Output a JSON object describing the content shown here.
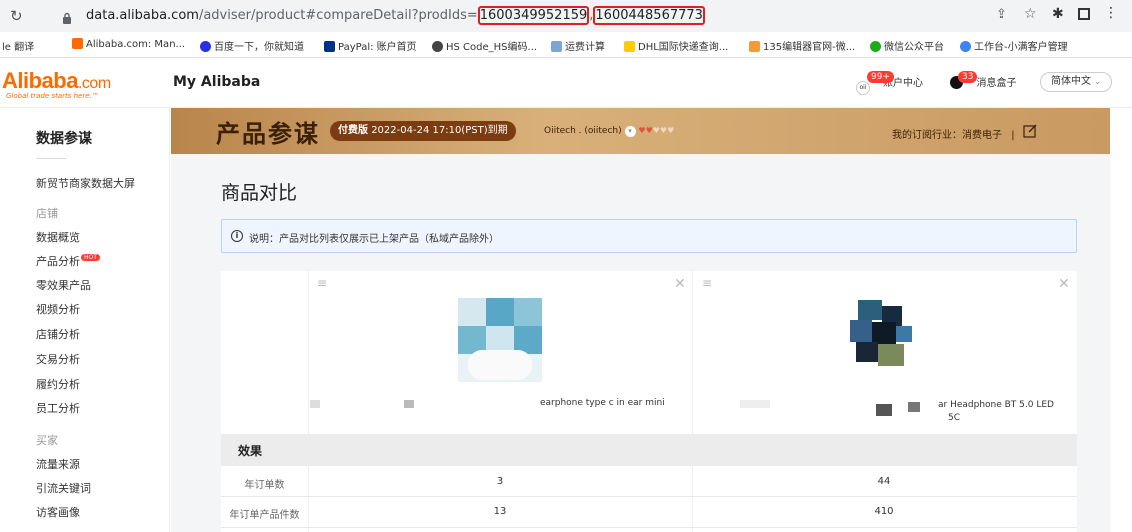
{
  "browser": {
    "url_host": "data.alibaba.com",
    "url_path_pre": "/adviser/product#compareDetail?prodIds=",
    "prod_id_1": "1600349952159",
    "url_comma": ",",
    "prod_id_2": "1600448567773",
    "bookmarks": [
      {
        "label": "le 翻译",
        "color": "#4285f4"
      },
      {
        "label": "Alibaba.com: Man...",
        "color": "#ff6a00"
      },
      {
        "label": "百度一下，你就知道",
        "color": "#2932e1"
      },
      {
        "label": "PayPal: 账户首页",
        "color": "#003087"
      },
      {
        "label": "HS Code_HS编码...",
        "color": "#444444"
      },
      {
        "label": "运费计算",
        "color": "#7aa6d6"
      },
      {
        "label": "DHL国际快递查询...",
        "color": "#ffcc00"
      },
      {
        "label": "135编辑器官网-微...",
        "color": "#f29b38"
      },
      {
        "label": "微信公众平台",
        "color": "#1aad19"
      },
      {
        "label": "工作台-小满客户管理",
        "color": "#3e82f7"
      }
    ]
  },
  "header": {
    "logo_main": "Alibaba",
    "logo_com": ".com",
    "logo_slogan": "Global trade starts here.™",
    "my_alibaba": "My Alibaba",
    "account_badge": "99+",
    "account_label": "账户中心",
    "msg_badge": "33",
    "msg_label": "消息盒子",
    "lang": "简体中文"
  },
  "sidebar": {
    "title": "数据参谋",
    "top_item": "新贸节商家数据大屏",
    "group_store": "店铺",
    "store_items": [
      "数据概览",
      "产品分析",
      "零效果产品",
      "视频分析",
      "店铺分析",
      "交易分析",
      "履约分析",
      "员工分析"
    ],
    "hot_tag": "HOT",
    "group_buyer": "买家",
    "buyer_items": [
      "流量来源",
      "引流关键词",
      "访客画像"
    ]
  },
  "banner": {
    "title": "产品参谋",
    "paid": "付费版",
    "expire": "2022-04-24 17:10(PST)到期",
    "store": "Oiitech . (oiitech)",
    "sub_industry": "我的订阅行业：消费电子"
  },
  "main": {
    "page_title": "商品对比",
    "notice": "说明：产品对比列表仅展示已上架产品（私域产品除外）",
    "product_1_name": "earphone type c in ear mini",
    "product_2_name": "ar Headphone BT 5.0 LED",
    "product_2_name2": "5C",
    "section": "效果",
    "rows": [
      {
        "label": "年订单数",
        "v1": "3",
        "v2": "44"
      },
      {
        "label": "年订单产品件数",
        "v1": "13",
        "v2": "410"
      }
    ]
  }
}
